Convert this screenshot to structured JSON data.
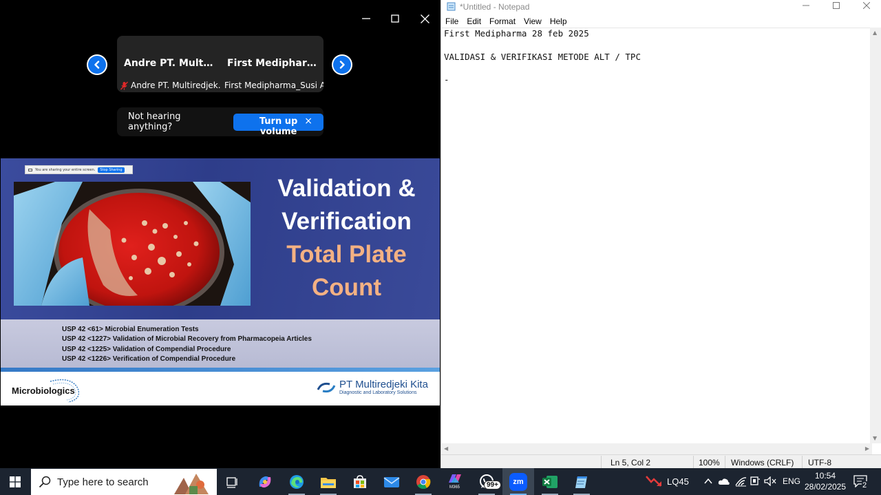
{
  "zoom": {
    "participants": [
      {
        "display_name": "Andre  PT. Multir...",
        "full_name": "Andre PT. Multiredjek...",
        "muted": true
      },
      {
        "display_name": "First  Medipharm...",
        "full_name": "First Medipharma_Susi A...",
        "muted": false
      }
    ],
    "volume_banner": {
      "text": "Not hearing anything?",
      "button_label": "Turn up volume",
      "close_glyph": "×"
    },
    "sharing_bar": {
      "text": "You are sharing your entire screen.",
      "stop_label": "Stop Sharing"
    },
    "slide": {
      "title_line1": "Validation &",
      "title_line2": "Verification",
      "subtitle_line1": "Total Plate",
      "subtitle_line2": "Count",
      "references": [
        "USP 42 <61> Microbial Enumeration Tests",
        "USP 42 <1227> Validation of Microbial Recovery from Pharmacopeia  Articles",
        "USP 42 <1225> Validation of Compendial Procedure",
        "USP 42 <1226> Verification of Compendial Procedure"
      ],
      "logo_left": "Microbiologics",
      "logo_right_name": "PT Multiredjeki Kita",
      "logo_right_sub": "Diagnostic and Laboratory Solutions"
    }
  },
  "notepad": {
    "title": "*Untitled - Notepad",
    "menu": [
      "File",
      "Edit",
      "Format",
      "View",
      "Help"
    ],
    "content": "First Medipharma 28 feb 2025\n\nVALIDASI & VERIFIKASI METODE ALT / TPC\n\n-",
    "status": {
      "position": "Ln 5, Col 2",
      "zoom": "100%",
      "line_ending": "Windows (CRLF)",
      "encoding": "UTF-8"
    }
  },
  "taskbar": {
    "search_placeholder": "Type here to search",
    "apps": [
      "task-view",
      "copilot",
      "edge",
      "file-explorer",
      "microsoft-store",
      "mail",
      "chrome",
      "microsoft-365",
      "whatsapp",
      "zoom",
      "excel",
      "notepad"
    ],
    "m365_label": "M365",
    "whatsapp_badge": "99+",
    "zoom_label": "zm",
    "stock_label": "LQ45",
    "language": "ENG",
    "time": "10:54",
    "date": "28/02/2025",
    "notification_count": "2"
  },
  "colors": {
    "zoom_blue": "#0e72ed",
    "slide_blue": "#2e3d8a",
    "slide_peach": "#f4b183",
    "taskbar_bg": "#1c2430"
  }
}
